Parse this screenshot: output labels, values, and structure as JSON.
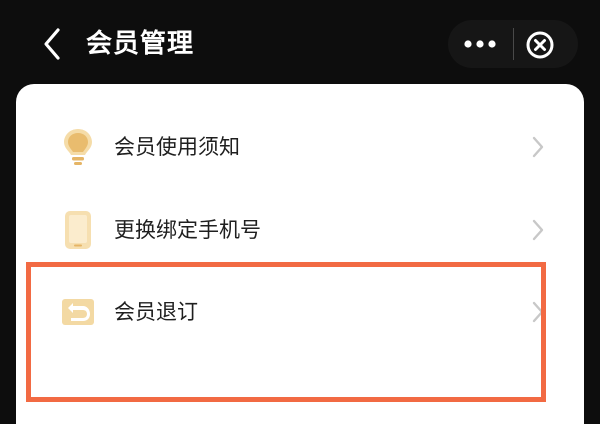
{
  "header": {
    "title": "会员管理",
    "back_icon": "chevron-left-icon",
    "more_icon": "more-dots-icon",
    "close_icon": "close-circle-icon"
  },
  "menu": {
    "items": [
      {
        "label": "会员使用须知",
        "icon": "lightbulb-icon"
      },
      {
        "label": "更换绑定手机号",
        "icon": "phone-icon"
      },
      {
        "label": "会员退订",
        "icon": "return-icon"
      }
    ],
    "chevron_icon": "chevron-right-icon"
  },
  "colors": {
    "header_bg": "#0d0d0d",
    "panel_bg": "#ffffff",
    "accent_gold": "#e5b566",
    "highlight": "#f26a43",
    "chevron": "#c8c8c8"
  }
}
